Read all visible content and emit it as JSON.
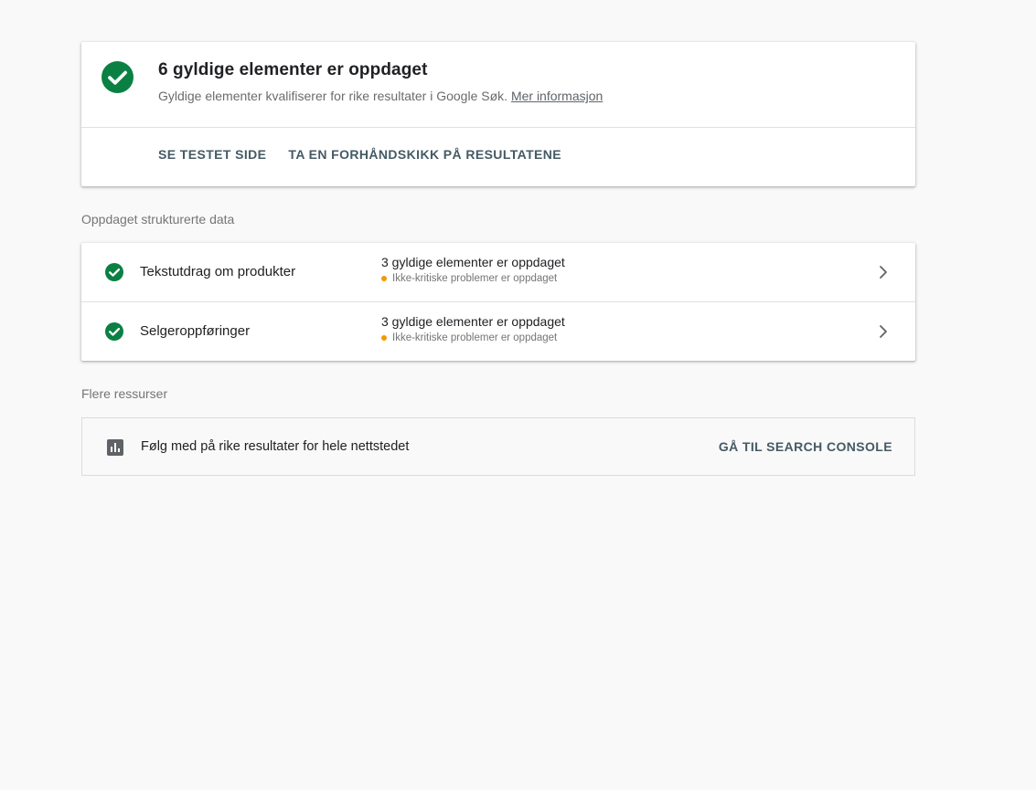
{
  "colors": {
    "valid_green": "#0b8043",
    "warning_orange": "#f29900",
    "action_text": "#455a64"
  },
  "summary": {
    "icon": "check-circle-icon",
    "title": "6 gyldige elementer er oppdaget",
    "subtitle": "Gyldige elementer kvalifiserer for rike resultater i Google Søk.",
    "link_label": "Mer informasjon",
    "actions": {
      "view_tested_page": "SE TESTET SIDE",
      "preview_results": "TA EN FORHÅNDSKIKK PÅ RESULTATENE"
    }
  },
  "structured_data": {
    "section_label": "Oppdaget strukturerte data",
    "items": [
      {
        "icon": "check-circle-icon",
        "title": "Tekstutdrag om produkter",
        "valid": "3 gyldige elementer er oppdaget",
        "warning": "Ikke-kritiske problemer er oppdaget"
      },
      {
        "icon": "check-circle-icon",
        "title": "Selgeroppføringer",
        "valid": "3 gyldige elementer er oppdaget",
        "warning": "Ikke-kritiske problemer er oppdaget"
      }
    ]
  },
  "resources": {
    "section_label": "Flere ressurser",
    "icon": "bar-chart-icon",
    "text": "Følg med på rike resultater for hele nettstedet",
    "button": "GÅ TIL SEARCH CONSOLE"
  }
}
